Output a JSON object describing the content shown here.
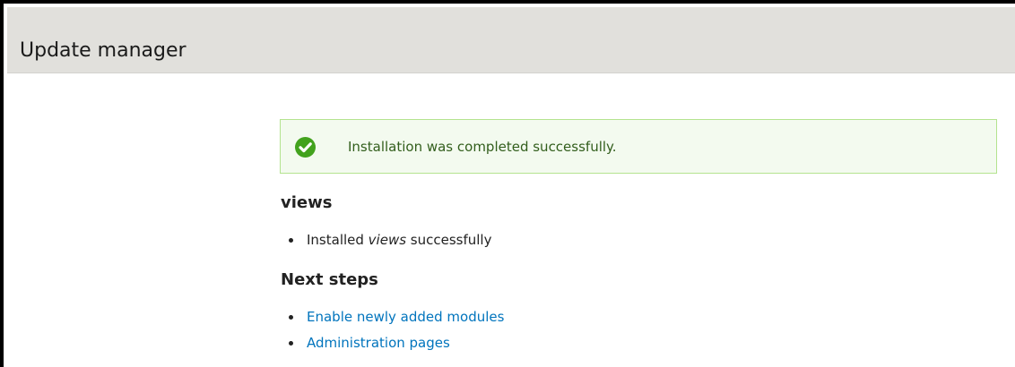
{
  "header": {
    "title": "Update manager"
  },
  "status_message": {
    "icon": "check-circle-icon",
    "text": "Installation was completed successfully.",
    "colors": {
      "background": "#f3faef",
      "border": "#b4e38f",
      "icon": "#42a21d",
      "text": "#325e1c"
    }
  },
  "project": {
    "heading": "views",
    "result": {
      "prefix": "Installed ",
      "name": "views",
      "suffix": " successfully"
    }
  },
  "next_steps": {
    "heading": "Next steps",
    "links": [
      {
        "label": "Enable newly added modules"
      },
      {
        "label": "Administration pages"
      }
    ],
    "link_color": "#0074bd"
  }
}
